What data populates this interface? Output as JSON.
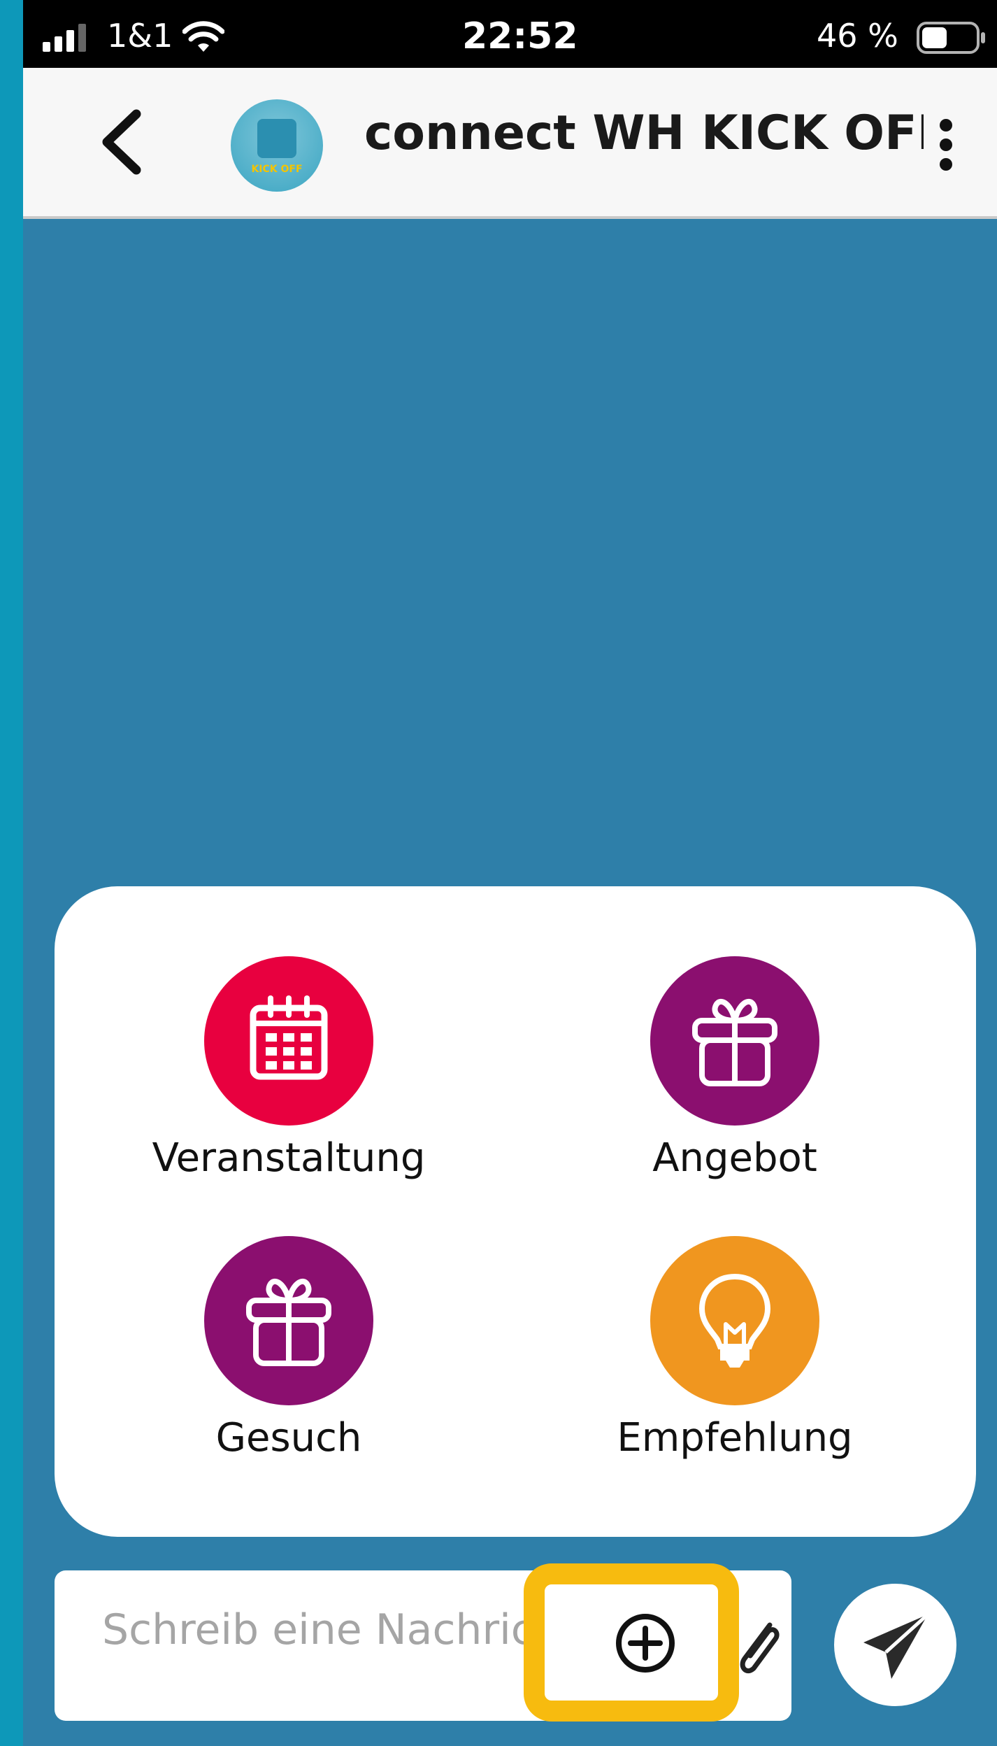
{
  "status_bar": {
    "carrier": "1&1",
    "time": "22:52",
    "battery_percent": "46 %",
    "battery_level": 0.46
  },
  "header": {
    "title": "connect WH KICK OFF a",
    "avatar_text": "KICK OFF"
  },
  "actions": [
    {
      "label": "Veranstaltung",
      "icon": "calendar-icon",
      "color": "#e8003f"
    },
    {
      "label": "Angebot",
      "icon": "gift-icon",
      "color": "#8b0f6f"
    },
    {
      "label": "Gesuch",
      "icon": "gift-icon",
      "color": "#8b0f6f"
    },
    {
      "label": "Empfehlung",
      "icon": "lightbulb-icon",
      "color": "#f0961f"
    }
  ],
  "composer": {
    "placeholder": "Schreib eine Nachricht",
    "highlight_color": "#f7bb0f"
  },
  "colors": {
    "chat_background": "#2e7fa9",
    "outer_background": "#0a97b8"
  }
}
